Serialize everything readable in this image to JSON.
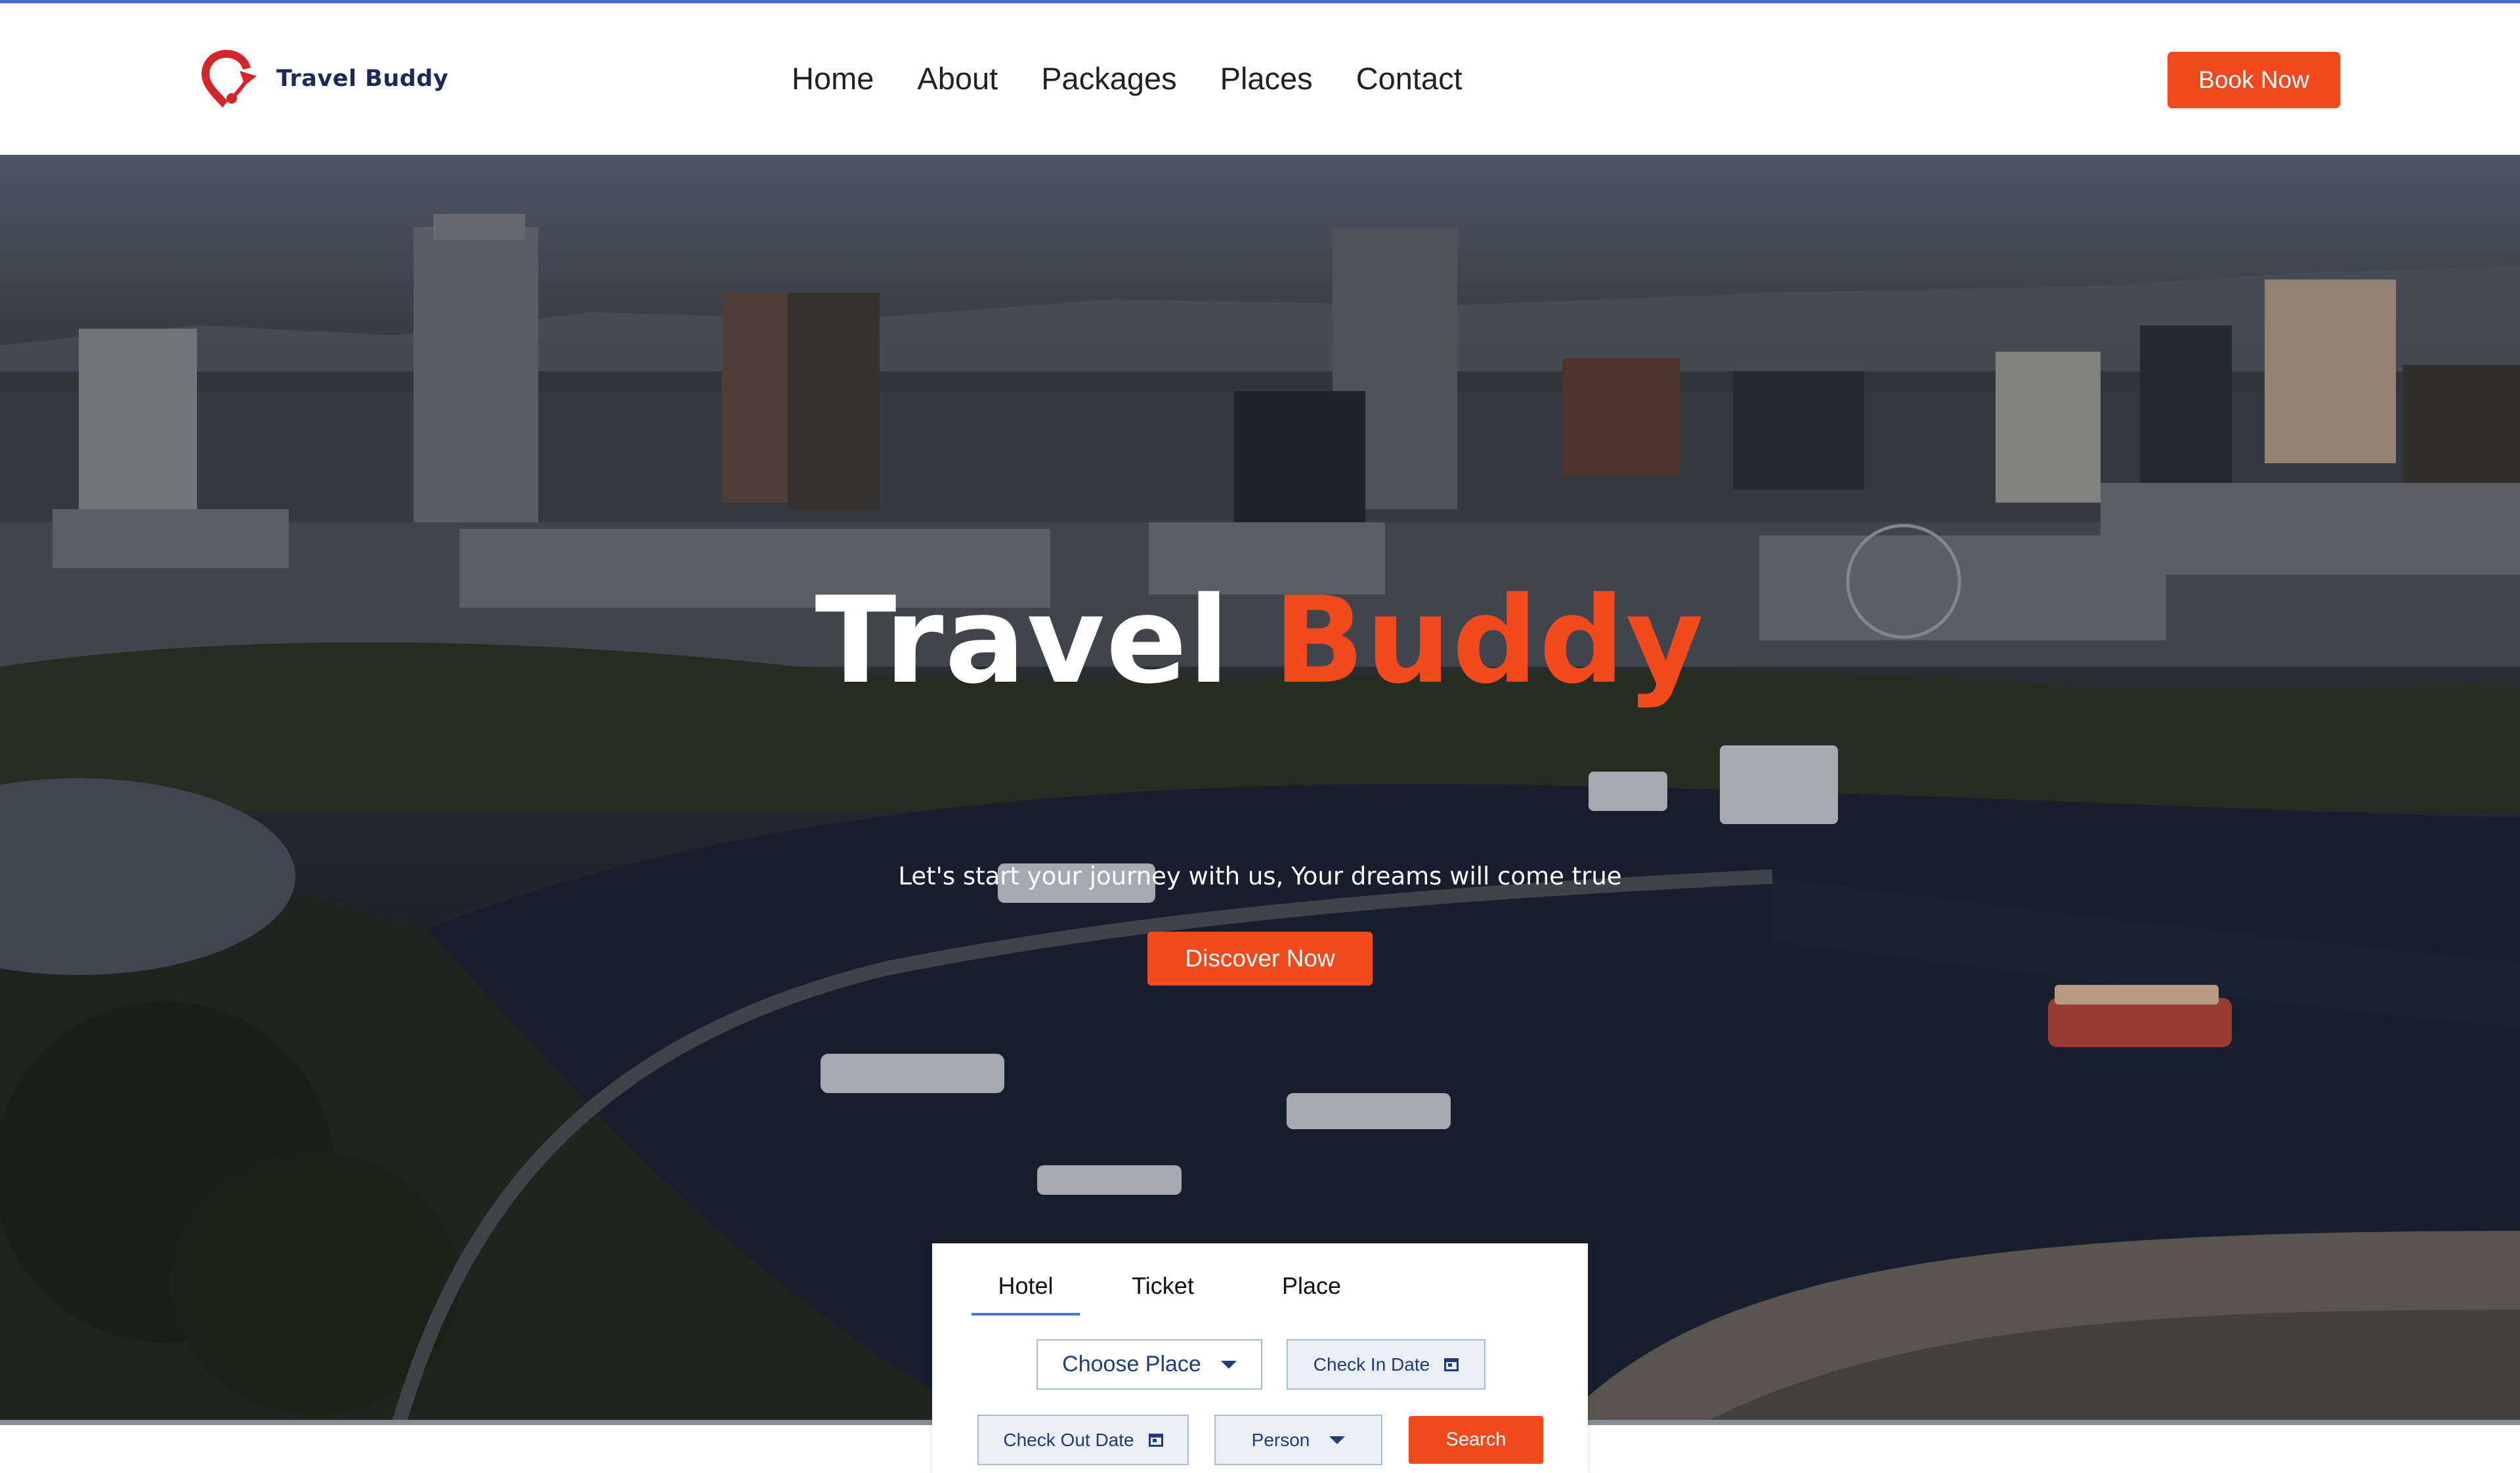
{
  "brand": {
    "name": "Travel Buddy",
    "accent_color": "#f24a1d",
    "logo_icon": "map-pin-arrow-icon"
  },
  "nav": {
    "items": [
      {
        "label": "Home"
      },
      {
        "label": "About"
      },
      {
        "label": "Packages"
      },
      {
        "label": "Places"
      },
      {
        "label": "Contact"
      }
    ],
    "cta_label": "Book Now"
  },
  "hero": {
    "title_part1": "Travel",
    "title_part2": "Buddy",
    "subtitle": "Let's start your journey with us, Your dreams will come true",
    "cta_label": "Discover Now",
    "background": "aerial city harbor at dusk"
  },
  "search": {
    "tabs": [
      {
        "label": "Hotel",
        "active": true
      },
      {
        "label": "Ticket",
        "active": false
      },
      {
        "label": "Place",
        "active": false
      }
    ],
    "place_select": "Choose Place",
    "check_in_label": "Check In Date",
    "check_out_label": "Check Out Date",
    "person_select": "Person",
    "search_label": "Search"
  }
}
